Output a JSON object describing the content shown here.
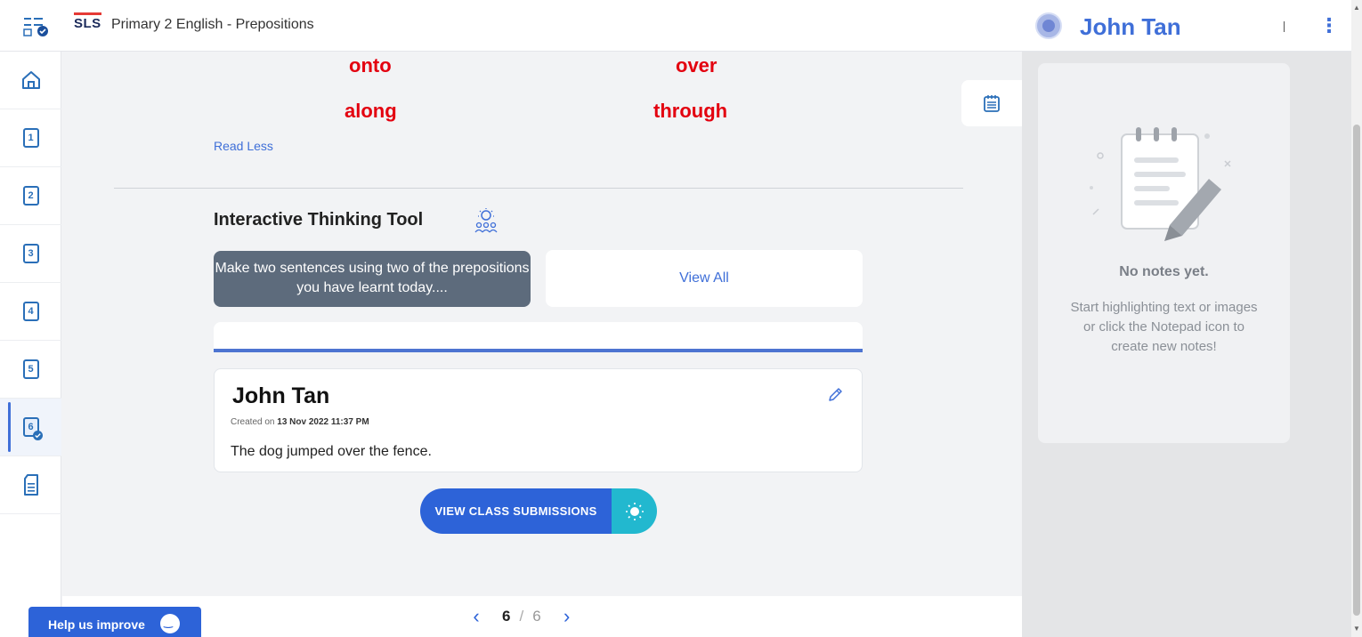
{
  "app": {
    "logo": "SLS",
    "course_title": "Primary 2 English - Prepositions",
    "user_name": "John Tan",
    "accent": "#3f6fd8"
  },
  "sidebar": {
    "items": [
      {
        "icon": "home-icon",
        "label": ""
      },
      {
        "icon": "page-icon",
        "label": "1"
      },
      {
        "icon": "page-icon",
        "label": "2"
      },
      {
        "icon": "page-icon",
        "label": "3"
      },
      {
        "icon": "page-icon",
        "label": "4"
      },
      {
        "icon": "page-icon",
        "label": "5"
      },
      {
        "icon": "page-check-icon",
        "label": "6"
      },
      {
        "icon": "notes-doc-icon",
        "label": ""
      }
    ],
    "active_index": 6
  },
  "content": {
    "words": [
      "onto",
      "over",
      "along",
      "through"
    ],
    "word_color": "#e3000f",
    "read_less": "Read Less",
    "itt_title": "Interactive Thinking Tool",
    "prompt": "Make two sentences using two of the prepositions you have learnt today....",
    "view_all": "View All",
    "submission": {
      "name": "John Tan",
      "created_prefix": "Created on ",
      "created_date": "13 Nov 2022 11:37 PM",
      "text": "The dog jumped over the fence."
    },
    "view_class_submissions": "VIEW CLASS SUBMISSIONS"
  },
  "notes": {
    "empty_title": "No notes yet.",
    "empty_desc": "Start highlighting text or images or click the Notepad icon to create new notes!"
  },
  "pager": {
    "current": "6",
    "separator": "/",
    "total": "6"
  },
  "help": {
    "label": "Help us improve"
  }
}
